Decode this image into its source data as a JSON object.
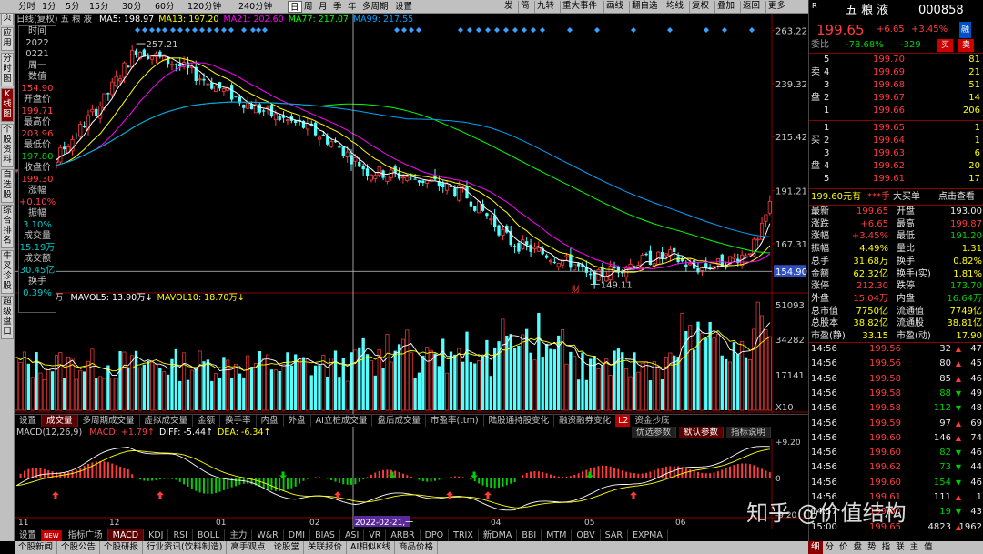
{
  "toolbar": {
    "period_tabs": [
      "分时",
      "1分",
      "5分",
      "15分",
      "30分",
      "60分",
      "120分钟",
      "240分钟",
      "日",
      "周",
      "月",
      "季",
      "年",
      "多周期",
      "设置"
    ],
    "active_period": "日",
    "right_buttons": [
      "发",
      "简",
      "九转",
      "重大事件",
      "画线",
      "翻自选",
      "均线",
      "复权",
      "叠加",
      "返回",
      "更多"
    ]
  },
  "left_tabs": [
    {
      "label": "首页",
      "active": false
    },
    {
      "label": "应用",
      "active": false
    },
    {
      "label": "分时图",
      "active": false
    },
    {
      "label": "K线图",
      "active": true
    },
    {
      "label": "个股资料",
      "active": false
    },
    {
      "label": "自选股",
      "active": false
    },
    {
      "label": "综合排名",
      "active": false
    },
    {
      "label": "牛叉诊股",
      "active": false
    },
    {
      "label": "超级盘口",
      "active": false
    }
  ],
  "main_legend": {
    "title": "日线(复权) 五 粮 液",
    "ma": [
      {
        "label": "MA5: 198.97",
        "color": "#ffffff"
      },
      {
        "label": "MA13: 197.20",
        "color": "#ffff00"
      },
      {
        "label": "MA21: 202.60",
        "color": "#ff00ff"
      },
      {
        "label": "MA77: 217.07",
        "color": "#00ff00"
      },
      {
        "label": "MA99: 217.55",
        "color": "#00a0ff"
      }
    ]
  },
  "price_axis": {
    "ticks": [
      "263.22",
      "239.32",
      "215.42",
      "191.21",
      "167.31"
    ],
    "current_tag": "154.90"
  },
  "annotations": {
    "high": "257.21",
    "low": "149.11",
    "fin_marker": "财"
  },
  "info_box": [
    {
      "k": "时间",
      "v": [
        "2022",
        "0221",
        "周一"
      ],
      "c": "vw"
    },
    {
      "k": "数值",
      "v": [
        "154.90"
      ],
      "c": "vr"
    },
    {
      "k": "开盘价",
      "v": [
        "199.71"
      ],
      "c": "vr"
    },
    {
      "k": "最高价",
      "v": [
        "203.96"
      ],
      "c": "vr"
    },
    {
      "k": "最低价",
      "v": [
        "197.80"
      ],
      "c": "vg"
    },
    {
      "k": "收盘价",
      "v": [
        "199.30"
      ],
      "c": "vr"
    },
    {
      "k": "涨幅",
      "v": [
        "+0.10%"
      ],
      "c": "vr"
    },
    {
      "k": "振幅",
      "v": [
        "3.10%"
      ],
      "c": "vc"
    },
    {
      "k": "成交量",
      "v": [
        "15.19万"
      ],
      "c": "vc"
    },
    {
      "k": "成交额",
      "v": [
        "30.45亿"
      ],
      "c": "vc"
    },
    {
      "k": "换手",
      "v": [
        "0.39%"
      ],
      "c": "vc"
    }
  ],
  "vol_legend": {
    "unit": "万",
    "items": [
      {
        "label": "MAVOL5: 13.90万↓",
        "color": "#ffffff"
      },
      {
        "label": "MAVOL10: 18.70万↓",
        "color": "#ffff00"
      }
    ]
  },
  "vol_axis": {
    "ticks": [
      "51093",
      "34282",
      "17141"
    ],
    "unit": "X10"
  },
  "ind_tabs1": {
    "tabs": [
      "设置",
      "成交量",
      "多周期成交量",
      "虚拟成交量",
      "金额",
      "换手率",
      "内盘",
      "外盘",
      "AI立桩成交量",
      "盘后成交量",
      "市盈率(ttm)",
      "陆股通持股变化",
      "融资融券变化",
      "资金抄底"
    ],
    "active": "成交量",
    "badge": "L2",
    "right": [
      "优选参数",
      "默认参数",
      "指标说明"
    ]
  },
  "macd_legend": {
    "name": "MACD(12,26,9)",
    "items": [
      {
        "label": "MACD: +1.79↑",
        "color": "#ff4040"
      },
      {
        "label": "DIFF: -5.44↑",
        "color": "#ffffff"
      },
      {
        "label": "DEA: -6.34↑",
        "color": "#ffff00"
      }
    ]
  },
  "macd_axis": {
    "ticks": [
      "+9.20",
      "0",
      "-9.20"
    ]
  },
  "x_axis": {
    "labels": [
      "11",
      "12",
      "01",
      "02",
      "03",
      "04",
      "05",
      "06"
    ],
    "cursor_date": "2022-02-21,一"
  },
  "ind_tabs2": {
    "tabs": [
      "设置",
      "指标广场",
      "MACD",
      "KDJ",
      "RSI",
      "BOLL",
      "主力",
      "W&R",
      "DMI",
      "BIAS",
      "ASI",
      "VR",
      "ARBR",
      "DPO",
      "TRIX",
      "新DMA",
      "BBI",
      "MTM",
      "OBV",
      "SAR",
      "EXPMA"
    ],
    "active": "MACD",
    "new": "NEW"
  },
  "link_bar": [
    "个股新闻",
    "个股公告",
    "个股研报",
    "行业资讯(饮料制造)",
    "高手观点",
    "论股堂",
    "关联报价",
    "AI相似K线",
    "商品价格"
  ],
  "right_panel": {
    "r_badge": "R",
    "stock_name": "五 粮 液",
    "stock_code": "000858",
    "price": "199.65",
    "change": "+6.65",
    "change_pct": "+3.45%",
    "tag": "融",
    "weibi_label": "委比",
    "weibi": "-78.68%",
    "weicha": "-329",
    "buy_btn": "买",
    "sell_btn": "卖",
    "sells": [
      {
        "n": "5",
        "p": "199.70",
        "v": "81"
      },
      {
        "n": "4",
        "p": "199.69",
        "v": "21"
      },
      {
        "n": "3",
        "p": "199.68",
        "v": "51"
      },
      {
        "n": "2",
        "p": "199.67",
        "v": "14"
      },
      {
        "n": "1",
        "p": "199.66",
        "v": "206"
      }
    ],
    "buys": [
      {
        "n": "1",
        "p": "199.65",
        "v": "1"
      },
      {
        "n": "2",
        "p": "199.64",
        "v": "1"
      },
      {
        "n": "3",
        "p": "199.63",
        "v": "6"
      },
      {
        "n": "4",
        "p": "199.62",
        "v": "20"
      },
      {
        "n": "5",
        "p": "199.61",
        "v": "17"
      }
    ],
    "sell_label": [
      "卖",
      "盘"
    ],
    "buy_label": [
      "买",
      "盘"
    ],
    "bigorder": {
      "price": "199.60元有",
      "qty": "***手",
      "label": "大买单",
      "link": "点击查看"
    },
    "stats": [
      {
        "l1": "最新",
        "v1": "199.65",
        "c1": "red",
        "l2": "开盘",
        "v2": "193.00",
        "c2": "wht"
      },
      {
        "l1": "涨跌",
        "v1": "+6.65",
        "c1": "red",
        "l2": "最高",
        "v2": "199.87",
        "c2": "red"
      },
      {
        "l1": "涨幅",
        "v1": "+3.45%",
        "c1": "red",
        "l2": "最低",
        "v2": "191.20",
        "c2": "grn"
      },
      {
        "l1": "振幅",
        "v1": "4.49%",
        "c1": "yel",
        "l2": "量比",
        "v2": "1.31",
        "c2": "yel"
      },
      {
        "l1": "总手",
        "v1": "31.68万",
        "c1": "yel",
        "l2": "换手",
        "v2": "0.82%",
        "c2": "yel"
      },
      {
        "l1": "金额",
        "v1": "62.32亿",
        "c1": "yel",
        "l2": "换手(实)",
        "v2": "1.81%",
        "c2": "yel"
      },
      {
        "l1": "涨停",
        "v1": "212.30",
        "c1": "red",
        "l2": "跌停",
        "v2": "173.70",
        "c2": "grn"
      },
      {
        "l1": "外盘",
        "v1": "15.04万",
        "c1": "red",
        "l2": "内盘",
        "v2": "16.64万",
        "c2": "grn"
      },
      {
        "l1": "总市值",
        "v1": "7750亿",
        "c1": "yel",
        "l2": "流通值",
        "v2": "7749亿",
        "c2": "yel"
      },
      {
        "l1": "总股本",
        "v1": "38.82亿",
        "c1": "yel",
        "l2": "流通股",
        "v2": "38.81亿",
        "c2": "yel"
      },
      {
        "l1": "市盈(静)",
        "v1": "33.15",
        "c1": "yel",
        "l2": "市盈(动)",
        "v2": "17.90",
        "c2": "yel"
      }
    ],
    "ticks": [
      {
        "t": "14:56",
        "p": "199.56",
        "v": "32",
        "d": "up"
      },
      {
        "t": "14:56",
        "p": "199.56",
        "v": "80",
        "d": "up"
      },
      {
        "t": "14:56",
        "p": "199.58",
        "v": "85",
        "d": "up"
      },
      {
        "t": "14:56",
        "p": "199.58",
        "v": "88",
        "d": "down"
      },
      {
        "t": "14:56",
        "p": "199.58",
        "v": "112",
        "d": "down"
      },
      {
        "t": "14:56",
        "p": "199.59",
        "v": "97",
        "d": "up"
      },
      {
        "t": "14:56",
        "p": "199.60",
        "v": "146",
        "d": "up"
      },
      {
        "t": "14:56",
        "p": "199.60",
        "v": "82",
        "d": "down"
      },
      {
        "t": "14:56",
        "p": "199.62",
        "v": "73",
        "d": "down"
      },
      {
        "t": "14:56",
        "p": "199.60",
        "v": "154",
        "d": "down"
      },
      {
        "t": "14:56",
        "p": "199.61",
        "v": "111",
        "d": "up"
      },
      {
        "t": "14:57",
        "p": "199.60",
        "v": "19",
        "d": "down"
      },
      {
        "t": "15:00",
        "p": "199.65",
        "v": "4823",
        "d": "up"
      }
    ],
    "tick_side": [
      "47",
      "45",
      "46",
      "49",
      "48",
      "69",
      "74",
      "46",
      "44",
      "46",
      "1",
      "43",
      "1962"
    ],
    "tabs": [
      "细",
      "分",
      "价",
      "盘",
      "势",
      "指",
      "联",
      "主",
      "值"
    ]
  },
  "watermark": "知乎 @价值结构"
}
